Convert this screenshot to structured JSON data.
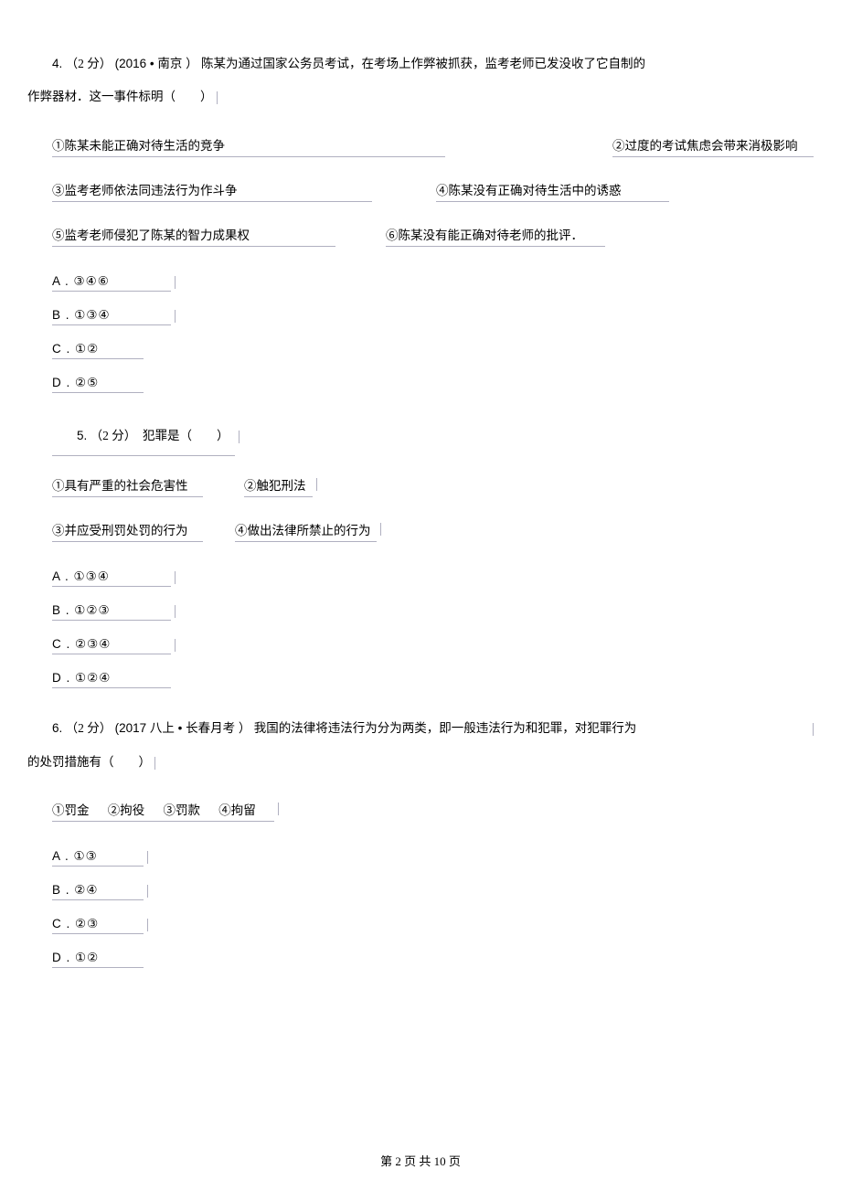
{
  "q4": {
    "number": "4.",
    "points": "（2 分）",
    "source": "(2016 • 南京 ）",
    "stem_a": "陈某为通过国家公务员考试，在考场上作弊被抓获，监考老师已发没收了它自制的",
    "stem_b": "作弊器材．这一事件标明（　　）",
    "s1": "①陈某未能正确对待生活的竞争",
    "s2": "②过度的考试焦虑会带来消极影响",
    "s3": "③监考老师依法同违法行为作斗争",
    "s4": "④陈某没有正确对待生活中的诱惑",
    "s5": "⑤监考老师侵犯了陈某的智力成果权",
    "s6": "⑥陈某没有能正确对待老师的批评．",
    "A": "A . ③④⑥",
    "B": "B . ①③④",
    "C": "C . ①②",
    "D": "D . ②⑤"
  },
  "q5": {
    "number": "5.",
    "points": "（2 分）",
    "stem": "犯罪是（　　）",
    "s1": "①具有严重的社会危害性",
    "s2": "②触犯刑法",
    "s3": "③并应受刑罚处罚的行为",
    "s4": "④做出法律所禁止的行为",
    "A": "A . ①③④",
    "B": "B . ①②③",
    "C": "C . ②③④",
    "D": "D . ①②④"
  },
  "q6": {
    "number": "6.",
    "points": "（2 分）",
    "source": "(2017  八上 • 长春月考  ）",
    "stem_a": "我国的法律将违法行为分为两类，即一般违法行为和犯罪，对犯罪行为",
    "stem_b": "的处罚措施有（　　）",
    "s1": "①罚金",
    "s2": "②拘役",
    "s3": "③罚款",
    "s4": "④拘留",
    "A": "A . ①③",
    "B": "B . ②④",
    "C": "C . ②③",
    "D": "D . ①②"
  },
  "footer": "第 2 页 共 10 页"
}
